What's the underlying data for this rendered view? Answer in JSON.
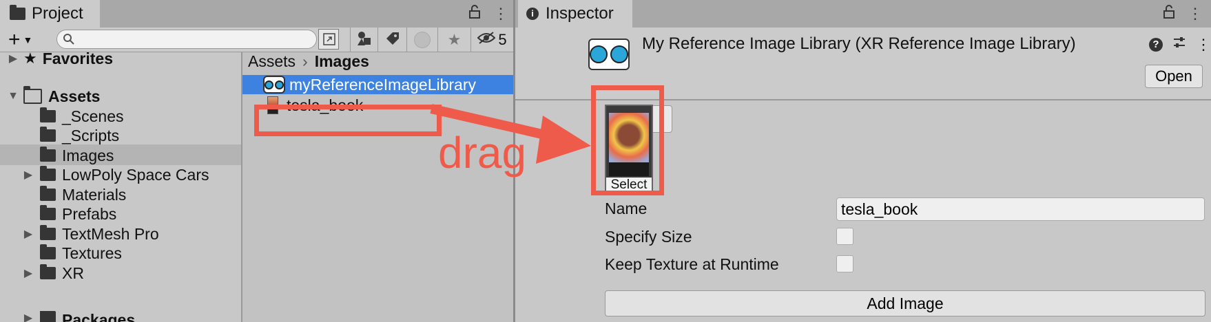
{
  "project_panel": {
    "tab_title": "Project",
    "hidden_count": "5",
    "search": {
      "value": "",
      "placeholder": ""
    },
    "tree": {
      "favorites": "Favorites",
      "assets": "Assets",
      "folders": [
        "_Scenes",
        "_Scripts",
        "Images",
        "LowPoly Space Cars",
        "Materials",
        "Prefabs",
        "TextMesh Pro",
        "Textures",
        "XR",
        "Packages"
      ]
    },
    "breadcrumb": {
      "root": "Assets",
      "current": "Images"
    },
    "files": [
      "myReferenceImageLibrary",
      "tesla_book"
    ]
  },
  "inspector": {
    "tab_title": "Inspector",
    "asset_title": "My Reference Image Library (XR Reference Image Library)",
    "open_label": "Open",
    "select_label": "Select",
    "name_label": "Name",
    "name_value": "tesla_book",
    "specify_size_label": "Specify Size",
    "keep_texture_label": "Keep Texture at Runtime",
    "add_image_label": "Add Image"
  },
  "annotation": {
    "drag_label": "drag",
    "color": "#ef5b4b"
  },
  "colors": {
    "selection": "#3d82e0",
    "panel": "#c8c8c8",
    "tabbar": "#a8a8a8"
  }
}
